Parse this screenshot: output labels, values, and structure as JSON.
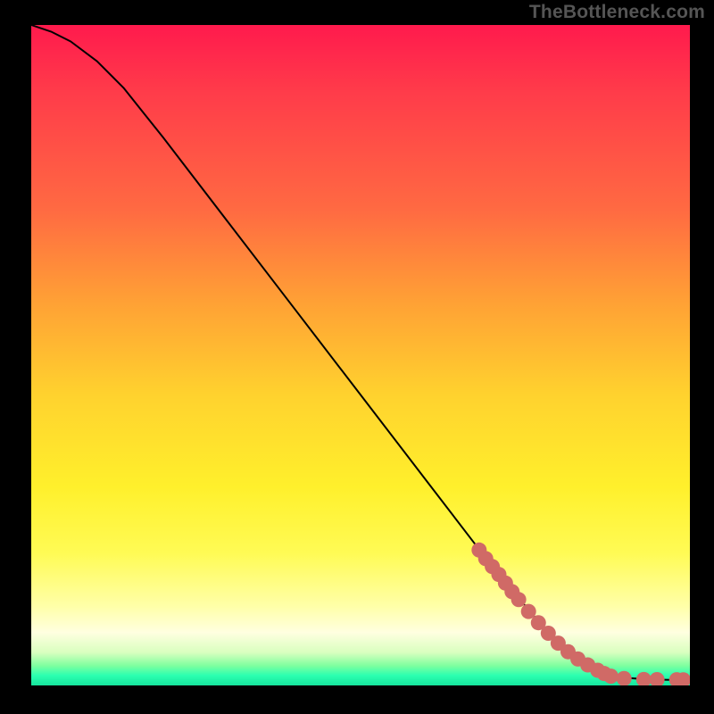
{
  "watermark": "TheBottleneck.com",
  "chart_data": {
    "type": "line",
    "title": "",
    "xlabel": "",
    "ylabel": "",
    "xlim": [
      0,
      100
    ],
    "ylim": [
      0,
      100
    ],
    "curve": {
      "x": [
        0,
        3,
        6,
        10,
        14,
        20,
        30,
        40,
        50,
        60,
        70,
        78,
        82,
        85,
        88,
        91,
        94,
        97,
        100
      ],
      "y": [
        100,
        99,
        97.5,
        94.5,
        90.5,
        83,
        70,
        57,
        44,
        31,
        18,
        8.5,
        5,
        3,
        1.7,
        1.1,
        0.9,
        0.85,
        0.85
      ]
    },
    "points": {
      "x": [
        68,
        69,
        70,
        71,
        72,
        73,
        74,
        75.5,
        77,
        78.5,
        80,
        81.5,
        83,
        84.5,
        86,
        87,
        88,
        90,
        93,
        95,
        98,
        99
      ],
      "y": [
        20.5,
        19.2,
        18,
        16.8,
        15.5,
        14.2,
        13,
        11.2,
        9.5,
        7.9,
        6.4,
        5.1,
        4,
        3.1,
        2.3,
        1.8,
        1.4,
        1.05,
        0.9,
        0.88,
        0.86,
        0.85
      ]
    },
    "gradient_stops": [
      {
        "pos": 0,
        "color": "#ff1a4d"
      },
      {
        "pos": 50,
        "color": "#ffd22e"
      },
      {
        "pos": 92,
        "color": "#ffffe0"
      },
      {
        "pos": 100,
        "color": "#16e59d"
      }
    ]
  }
}
